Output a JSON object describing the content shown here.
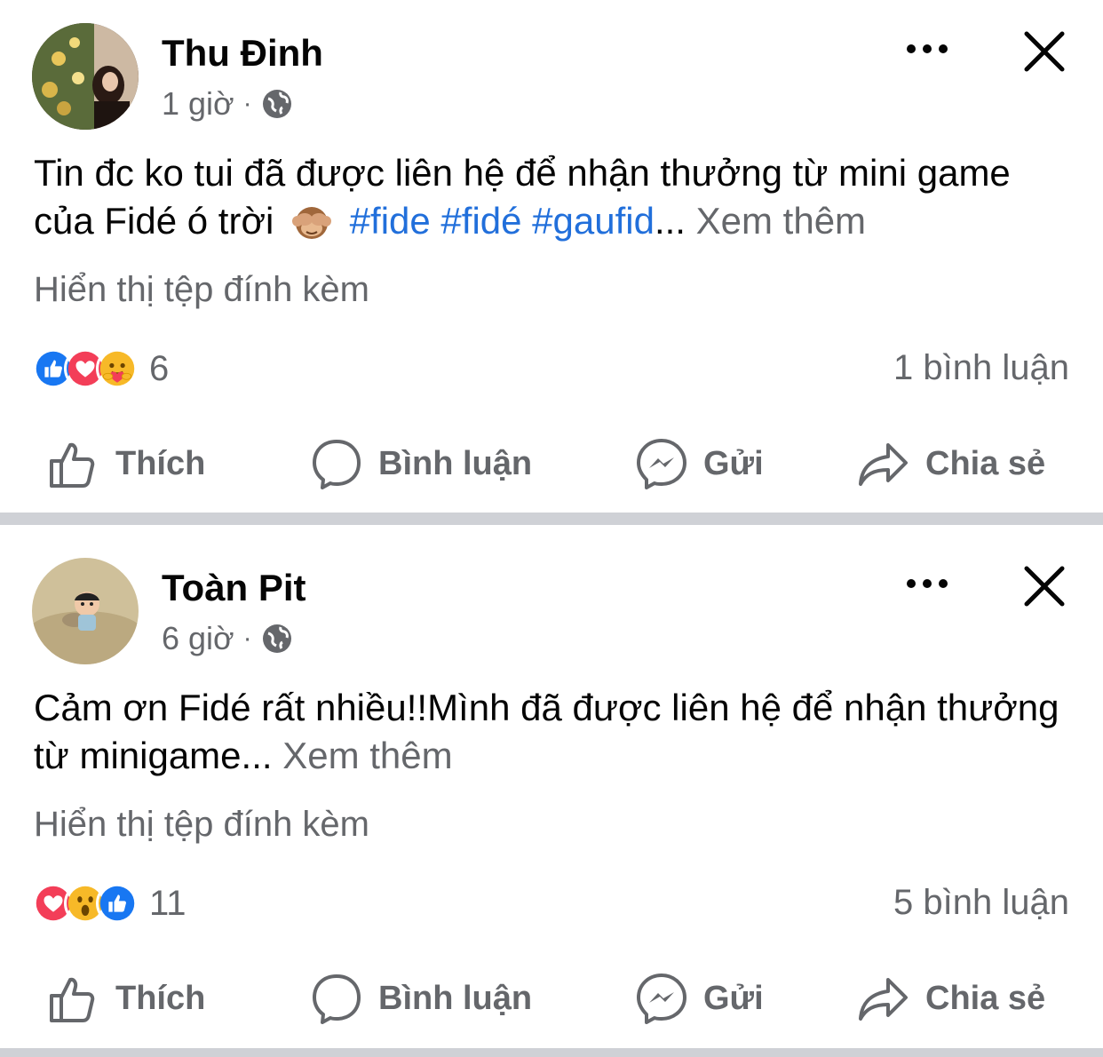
{
  "posts": [
    {
      "author": "Thu Đinh",
      "time": "1 giờ",
      "body": "Tin đc ko tui đã được liên hệ để nhận thưởng từ mini game của Fidé ó trời",
      "emoji_icon": "see-no-evil-monkey-icon",
      "hashtags": "#fide #fidé #gaufid",
      "ellipsis": "...",
      "see_more": "Xem thêm",
      "attachment_link": "Hiển thị tệp đính kèm",
      "reactions": [
        "like",
        "love",
        "care"
      ],
      "reaction_count": "6",
      "comment_count": "1 bình luận"
    },
    {
      "author": "Toàn Pit",
      "time": "6 giờ",
      "body": "Cảm ơn Fidé rất nhiều!!Mình đã được liên hệ để nhận thưởng từ minigame...",
      "see_more": "Xem thêm",
      "attachment_link": "Hiển thị tệp đính kèm",
      "reactions": [
        "love",
        "wow",
        "like"
      ],
      "reaction_count": "11",
      "comment_count": "5 bình luận"
    }
  ],
  "actions": {
    "like": "Thích",
    "comment": "Bình luận",
    "send": "Gửi",
    "share": "Chia sẻ"
  },
  "colors": {
    "text_primary": "#050505",
    "text_secondary": "#65676b",
    "hashtag": "#216fdb",
    "divider": "#cfd1d6",
    "like_blue": "#1877f2",
    "love_red": "#f33e58",
    "reaction_yellow": "#f7b928"
  }
}
